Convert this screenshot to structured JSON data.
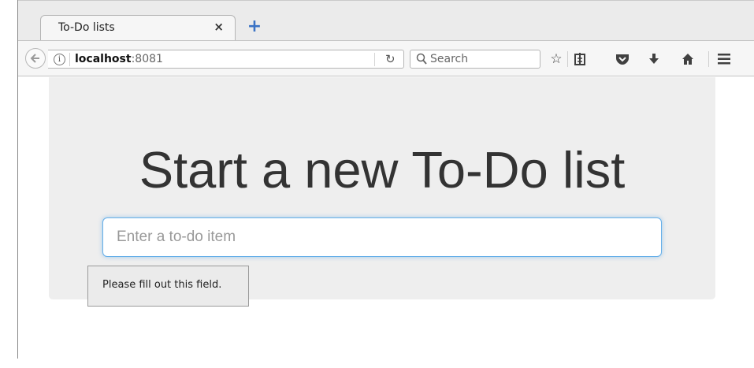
{
  "browser": {
    "tab_title": "To-Do lists",
    "tab_close": "×",
    "new_tab": "+",
    "url_host": "localhost",
    "url_port": ":8081",
    "search_placeholder": "Search"
  },
  "toolbar": {
    "icons": [
      "bookmark-star-icon",
      "reading-list-icon",
      "pocket-icon",
      "downloads-icon",
      "home-icon",
      "menu-icon"
    ]
  },
  "page": {
    "heading": "Start a new To-Do list",
    "input_placeholder": "Enter a to-do item",
    "input_value": "",
    "validation_message": "Please fill out this field."
  },
  "colors": {
    "jumbotron_bg": "#eeeeee",
    "input_focus_border": "#66afe9",
    "new_tab_accent": "#3b73c5"
  }
}
